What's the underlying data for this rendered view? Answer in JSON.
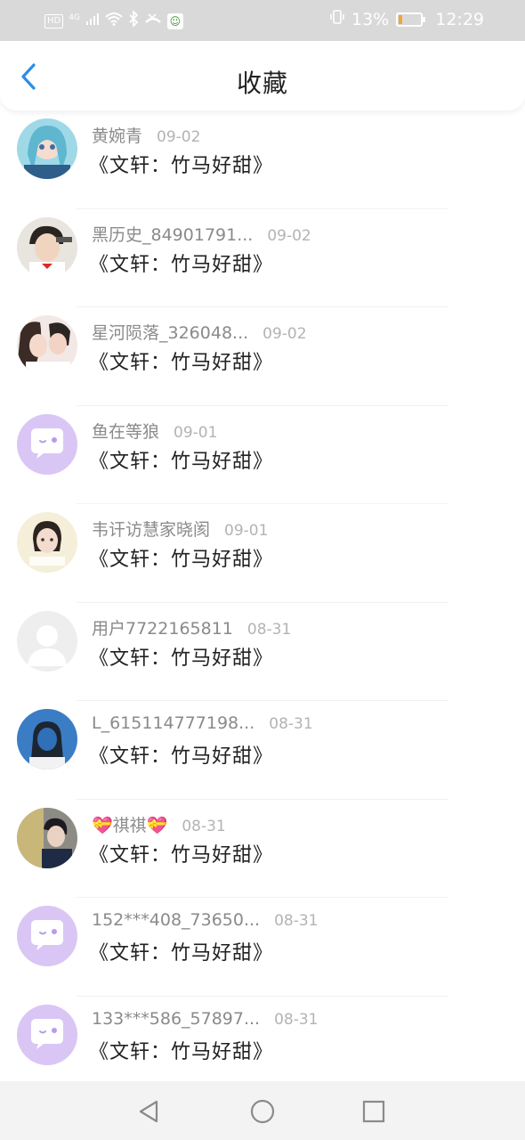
{
  "status_bar": {
    "network_badge": "HD",
    "network_type": "4G",
    "battery_percent": "13%",
    "battery_level": 0.13,
    "time": "12:29"
  },
  "header": {
    "title": "收藏",
    "back_icon": "chevron-left-icon"
  },
  "colors": {
    "accent": "#2c8de8",
    "status_bar_bg": "#d9d9d9",
    "default_avatar_bg": "#d9c6f5",
    "nav_bar_bg": "#f3f3f3"
  },
  "favorites": [
    {
      "name": "黄婉青",
      "date": "09-02",
      "title": "《文轩：竹马好甜》",
      "avatar": "anime-girl-avatar"
    },
    {
      "name": "黑历史_84901791...",
      "date": "09-02",
      "title": "《文轩：竹马好甜》",
      "avatar": "boy-photo-avatar"
    },
    {
      "name": "星河陨落_326048...",
      "date": "09-02",
      "title": "《文轩：竹马好甜》",
      "avatar": "couple-photo-avatar"
    },
    {
      "name": "鱼在等狼",
      "date": "09-01",
      "title": "《文轩：竹马好甜》",
      "avatar": "default-chat-avatar"
    },
    {
      "name": "韦讦访慧家晓阂",
      "date": "09-01",
      "title": "《文轩：竹马好甜》",
      "avatar": "girl-sticker-avatar"
    },
    {
      "name": "用户7722165811",
      "date": "08-31",
      "title": "《文轩：竹马好甜》",
      "avatar": "blank-user-avatar"
    },
    {
      "name": "L_615114777198...",
      "date": "08-31",
      "title": "《文轩：竹马好甜》",
      "avatar": "blue-girl-avatar"
    },
    {
      "name": "💝祺祺💝",
      "date": "08-31",
      "title": "《文轩：竹马好甜》",
      "avatar": "idol-photo-avatar"
    },
    {
      "name": "152***408_73650...",
      "date": "08-31",
      "title": "《文轩：竹马好甜》",
      "avatar": "default-chat-avatar"
    },
    {
      "name": "133***586_57897...",
      "date": "08-31",
      "title": "《文轩：竹马好甜》",
      "avatar": "default-chat-avatar"
    }
  ],
  "nav_bar": {
    "back_icon": "triangle-back-icon",
    "home_icon": "circle-home-icon",
    "recents_icon": "square-recents-icon"
  }
}
